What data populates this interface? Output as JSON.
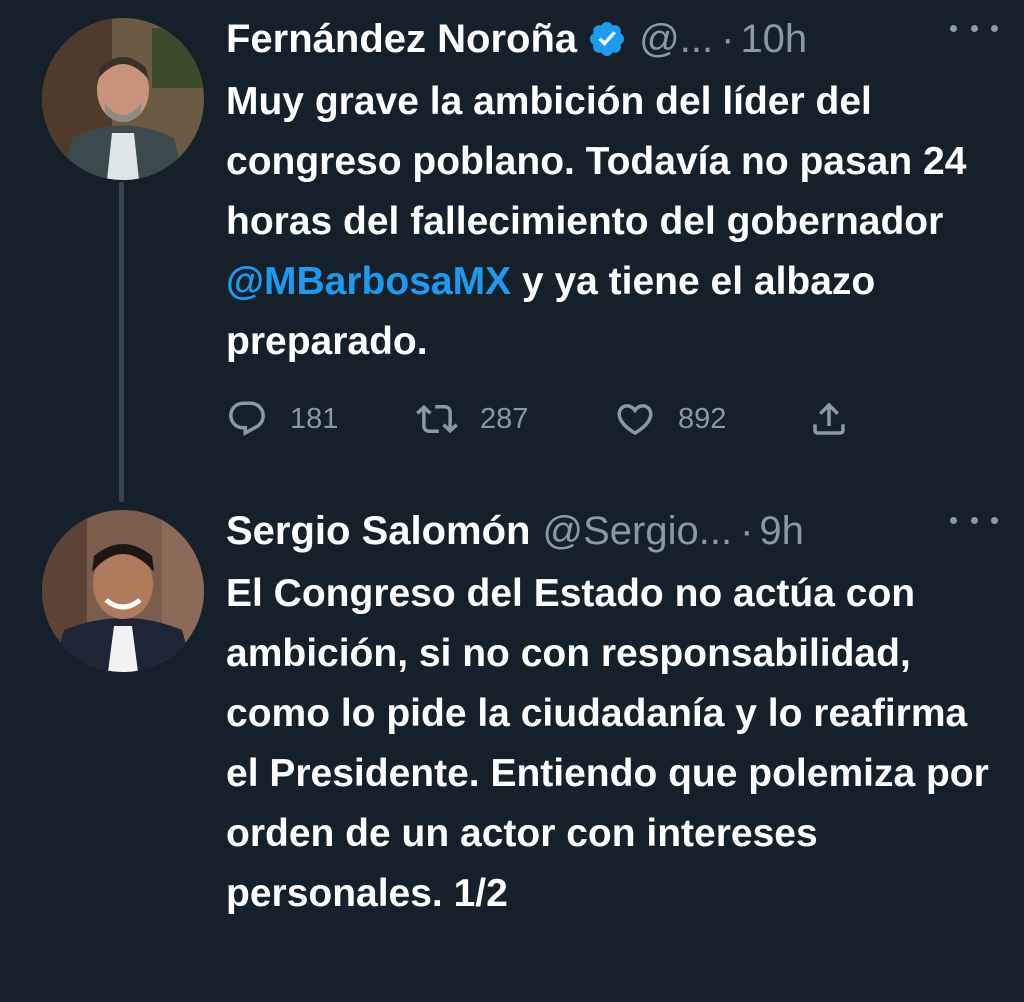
{
  "tweets": [
    {
      "name": "Fernández Noroña",
      "verified": true,
      "handle": "@...",
      "separator": "·",
      "time": "10h",
      "text_parts": {
        "before": "Muy grave la ambición del líder del congreso poblano. Todavía no pasan 24 horas del fallecimiento del gobernador ",
        "mention": "@MBarbosaMX",
        "after": " y ya tiene el albazo preparado."
      },
      "stats": {
        "replies": "181",
        "retweets": "287",
        "likes": "892"
      }
    },
    {
      "name": "Sergio Salomón",
      "verified": false,
      "handle": "@Sergio...",
      "separator": "·",
      "time": "9h",
      "text": "El Congreso del Estado no actúa con ambición, si no con responsabilidad, como lo pide la ciudadanía y lo reafirma el Presidente. Entiendo que polemiza por orden de un actor con intereses personales. 1/2"
    }
  ],
  "icons": {
    "verified": "verified-badge-icon",
    "more": "more-horizontal-icon",
    "reply": "reply-bubble-icon",
    "retweet": "retweet-icon",
    "like": "heart-icon",
    "share": "share-icon"
  },
  "colors": {
    "background": "#15202b",
    "text": "#ffffff",
    "secondary": "#8b98a5",
    "accent": "#1d9bf0",
    "thread_line": "#38444d"
  }
}
